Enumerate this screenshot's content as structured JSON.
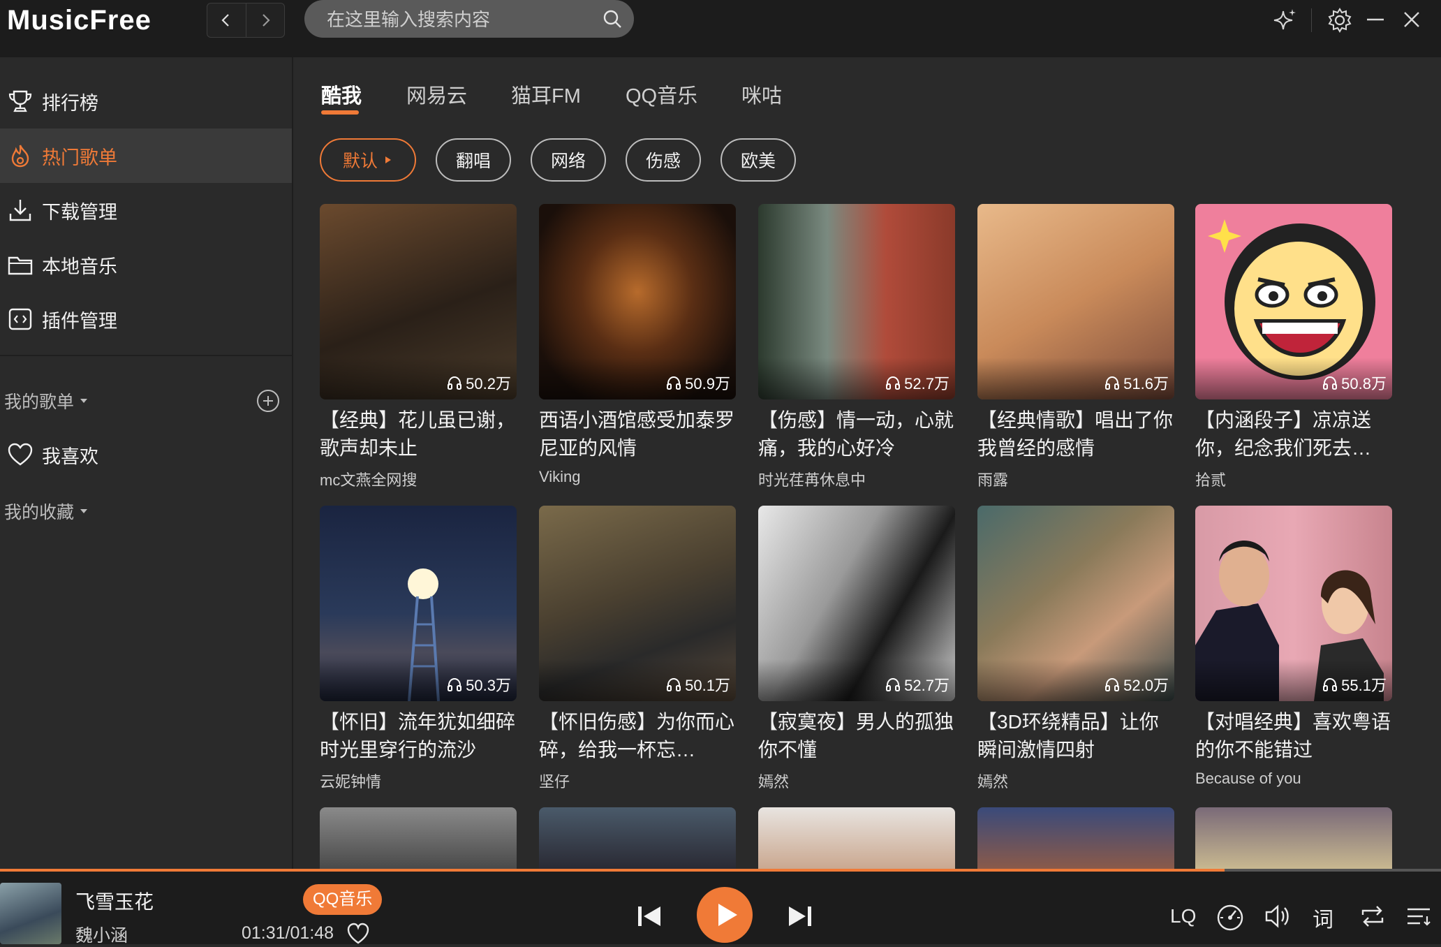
{
  "app": {
    "name": "MusicFree"
  },
  "search": {
    "placeholder": "在这里输入搜索内容"
  },
  "sidebar": {
    "items": [
      {
        "label": "排行榜",
        "icon": "trophy-icon",
        "active": false
      },
      {
        "label": "热门歌单",
        "icon": "fire-icon",
        "active": true
      },
      {
        "label": "下载管理",
        "icon": "download-icon",
        "active": false
      },
      {
        "label": "本地音乐",
        "icon": "folder-icon",
        "active": false
      },
      {
        "label": "插件管理",
        "icon": "plugin-icon",
        "active": false
      }
    ],
    "my_playlists": "我的歌单",
    "favorites": "我喜欢",
    "my_collections": "我的收藏"
  },
  "tabs": [
    "酷我",
    "网易云",
    "猫耳FM",
    "QQ音乐",
    "咪咕"
  ],
  "active_tab": "酷我",
  "chips": [
    "默认",
    "翻唱",
    "网络",
    "伤感",
    "欧美"
  ],
  "active_chip": "默认",
  "cards": [
    {
      "title": "【经典】花儿虽已谢，歌声却未止",
      "author": "mc文燕全网搜",
      "plays": "50.2万"
    },
    {
      "title": "西语小酒馆感受加泰罗尼亚的风情",
      "author": "Viking",
      "plays": "50.9万"
    },
    {
      "title": "【伤感】情一动，心就痛，我的心好冷",
      "author": "时光荏苒休息中",
      "plays": "52.7万"
    },
    {
      "title": "【经典情歌】唱出了你我曾经的感情",
      "author": "雨露",
      "plays": "51.6万"
    },
    {
      "title": "【内涵段子】凉凉送你，纪念我们死去…",
      "author": "拾贰",
      "plays": "50.8万"
    },
    {
      "title": "【怀旧】流年犹如细碎时光里穿行的流沙",
      "author": "云妮钟情",
      "plays": "50.3万"
    },
    {
      "title": "【怀旧伤感】为你而心碎，给我一杯忘…",
      "author": "坚仔",
      "plays": "50.1万"
    },
    {
      "title": "【寂寞夜】男人的孤独你不懂",
      "author": "嫣然",
      "plays": "52.7万"
    },
    {
      "title": "【3D环绕精品】让你瞬间激情四射",
      "author": "嫣然",
      "plays": "52.0万"
    },
    {
      "title": "【对唱经典】喜欢粤语的你不能错过",
      "author": "Because of you",
      "plays": "55.1万"
    }
  ],
  "player": {
    "title": "飞雪玉花",
    "artist": "魏小涵",
    "source": "QQ音乐",
    "time": "01:31/01:48",
    "progress": 0.85,
    "quality": "LQ",
    "lyrics_label": "词"
  },
  "colors": {
    "accent": "#f07a37",
    "background": "#2a2a2a",
    "topbar": "#1c1c1c"
  }
}
